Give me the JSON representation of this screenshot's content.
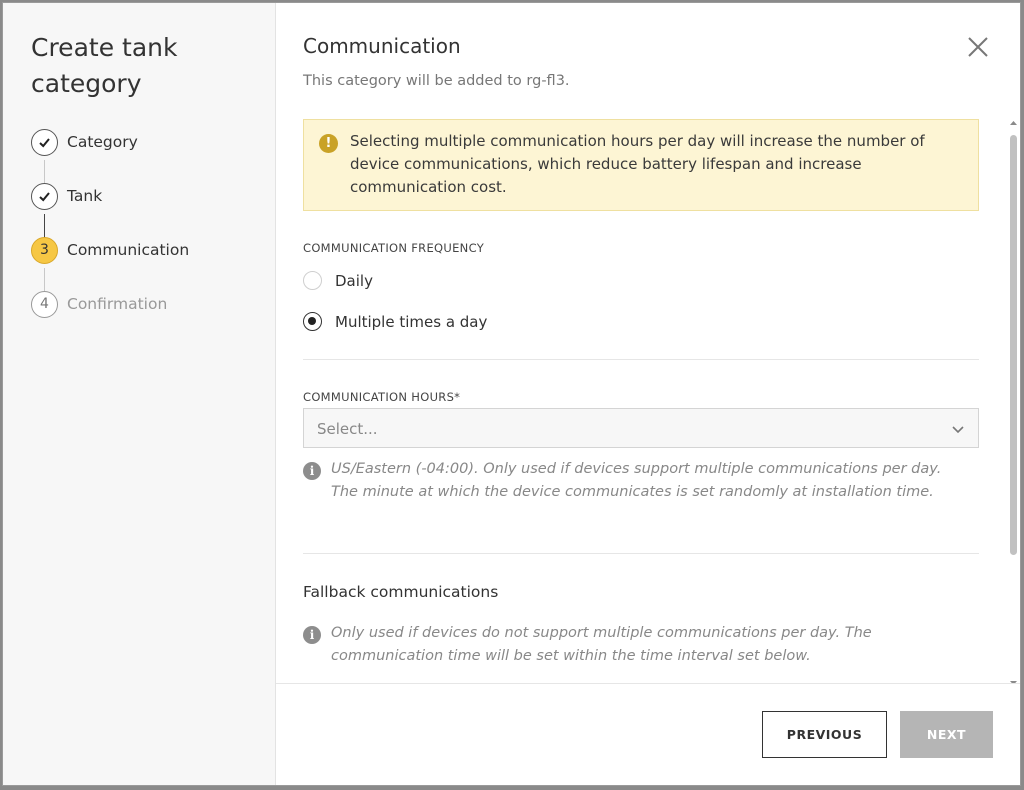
{
  "sidebar": {
    "title": "Create tank category",
    "steps": [
      {
        "number": "1",
        "label": "Category",
        "state": "completed"
      },
      {
        "number": "2",
        "label": "Tank",
        "state": "completed"
      },
      {
        "number": "3",
        "label": "Communication",
        "state": "current"
      },
      {
        "number": "4",
        "label": "Confirmation",
        "state": "pending"
      }
    ]
  },
  "header": {
    "title": "Communication",
    "subtitle": "This category will be added to rg-fl3."
  },
  "warning": {
    "icon": "exclamation-icon",
    "text": "Selecting multiple communication hours per day will increase the number of device communications, which reduce battery lifespan and increase communication cost."
  },
  "frequency": {
    "label": "COMMUNICATION FREQUENCY",
    "options": [
      {
        "label": "Daily",
        "checked": false
      },
      {
        "label": "Multiple times a day",
        "checked": true
      }
    ]
  },
  "hours": {
    "label": "COMMUNICATION HOURS*",
    "placeholder": "Select...",
    "info": "US/Eastern (-04:00). Only used if devices support multiple communications per day. The minute at which the device communicates is set randomly at installation time."
  },
  "fallback": {
    "title": "Fallback communications",
    "info": "Only used if devices do not support multiple communications per day. The communication time will be set within the time interval set below."
  },
  "footer": {
    "previous_label": "PREVIOUS",
    "next_label": "NEXT"
  },
  "colors": {
    "current_step": "#f6c744",
    "warning_bg": "#fdf5d4",
    "warning_icon": "#c9a227",
    "next_disabled": "#b5b5b5"
  }
}
